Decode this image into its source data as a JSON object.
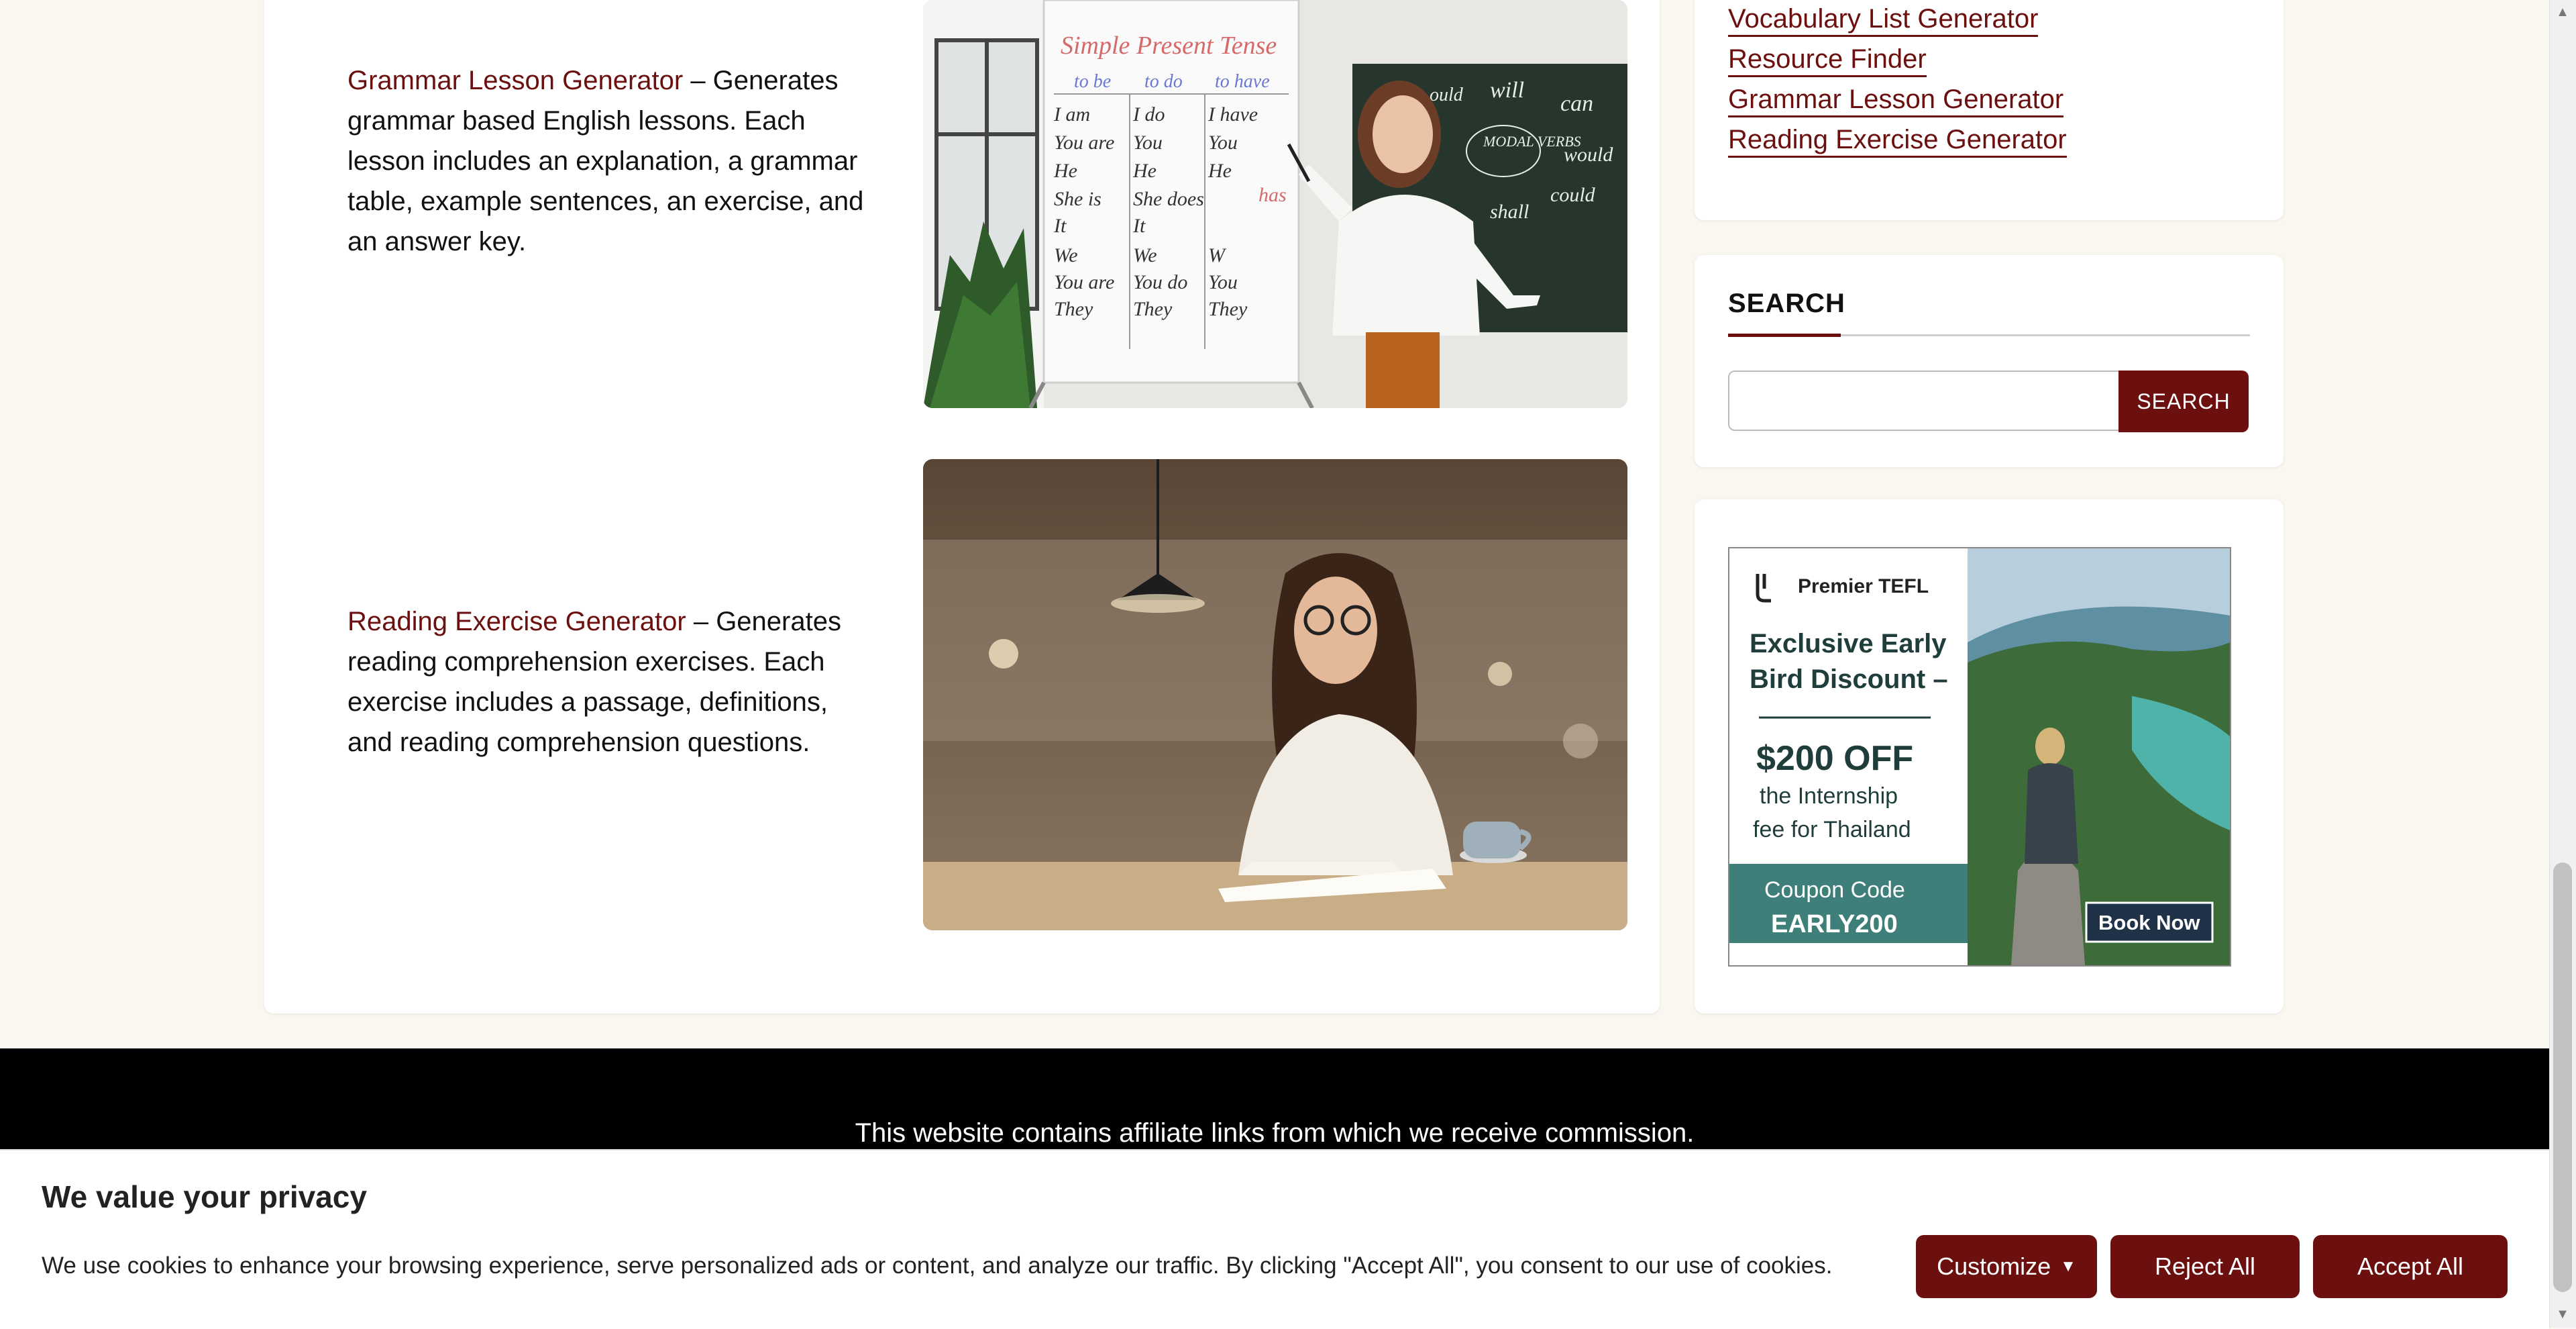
{
  "main": {
    "tools": [
      {
        "link": "Grammar Lesson Generator",
        "description": " – Generates grammar based English lessons. Each lesson includes an explanation, a grammar table, example sentences, an exercise, and an answer key."
      },
      {
        "link": "Reading Exercise Generator",
        "description": " – Generates reading comprehension exercises. Each exercise includes a passage, definitions, and reading comprehension questions."
      }
    ],
    "whiteboard": {
      "title": "Simple Present Tense",
      "cols": [
        "to be",
        "to do",
        "to have"
      ],
      "col1": [
        "I am",
        "You are",
        "He",
        "She is",
        "It",
        "We",
        "You are",
        "They"
      ],
      "col2": [
        "I do",
        "You",
        "He",
        "She does",
        "It",
        "We",
        "You do",
        "They"
      ],
      "col3": [
        "I have",
        "You",
        "He",
        "has",
        "",
        "W",
        "You",
        "They"
      ],
      "chalk_center": "MODAL VERBS",
      "chalk_words": [
        "will",
        "can",
        "would",
        "could",
        "shall",
        "ould"
      ]
    }
  },
  "sidebar": {
    "links": [
      "Vocabulary List Generator",
      "Resource Finder",
      "Grammar Lesson Generator",
      "Reading Exercise Generator"
    ],
    "search": {
      "title": "SEARCH",
      "button": "SEARCH",
      "placeholder": ""
    },
    "ad": {
      "brand": "Premier TEFL",
      "headline_1": "Exclusive Early",
      "headline_2": "Bird Discount –",
      "offer": "$200 OFF",
      "sub_1": "the Internship",
      "sub_2": "fee for Thailand",
      "coupon_label": "Coupon Code",
      "coupon_code": "EARLY200",
      "cta": "Book Now"
    }
  },
  "footer": {
    "text": "This website contains affiliate links from which we receive commission."
  },
  "cookie": {
    "title": "We value your privacy",
    "text": "We use cookies to enhance your browsing experience, serve personalized ads or content, and analyze our traffic. By clicking \"Accept All\", you consent to our use of cookies.",
    "customize": "Customize",
    "reject": "Reject All",
    "accept": "Accept All"
  },
  "colors": {
    "accent": "#6b0f0f",
    "page_bg": "#faf6f0",
    "ad_teal": "#3f7f7a"
  }
}
